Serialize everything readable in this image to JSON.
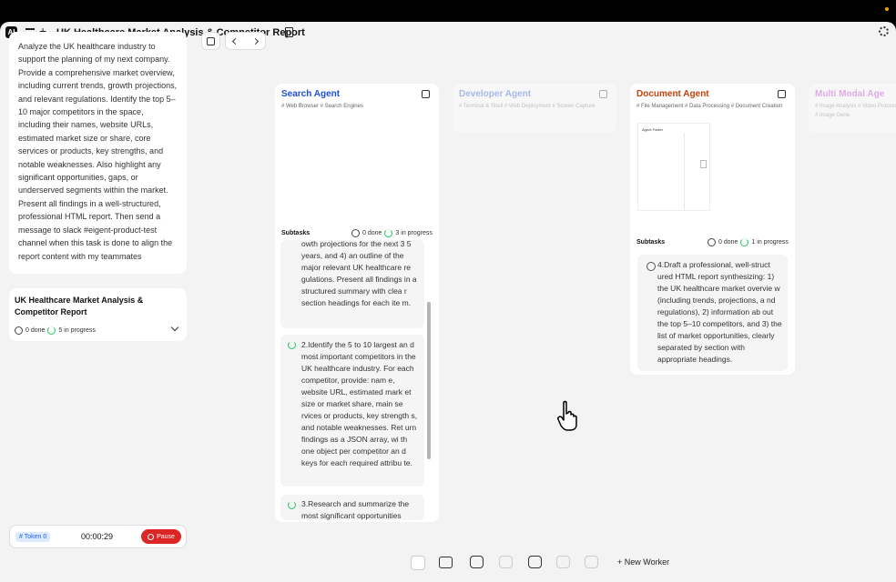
{
  "app": {
    "logo": "AI",
    "title": "UK Healthcare Market Analysis & Competitor Report"
  },
  "prompt": {
    "text": "Analyze the UK healthcare industry to support the planning of my next company. Provide a comprehensive market overview, including current trends, growth projections, and relevant regulations. Identify the top 5–10 major competitors in the space, including their names, website URLs, estimated market size or share, core services or products, key strengths, and notable weaknesses. Also highlight any significant opportunities, gaps, or underserved segments within the market. Present all findings in a well-structured, professional HTML report. Then send a message to slack #eigent-product-test channel when this task is done to align the report content with my teammates"
  },
  "task": {
    "title": "UK Healthcare Market Analysis & Competitor Report",
    "done": "0 done",
    "in_progress": "5 in progress"
  },
  "controls": {
    "token": "# Token 0",
    "timer": "00:00:29",
    "pause": "Pause"
  },
  "agents": [
    {
      "name": "Search Agent",
      "tags": "# Web Browser # Search Engines",
      "color": "#1d4ed8",
      "subtasks_label": "Subtasks",
      "done": "0 done",
      "in_progress": "3 in progress",
      "subtasks": [
        {
          "text": "owth projections for the next 3 5 years, and 4) an outline of the major relevant UK healthcare re gulations. Present all findings in a structured summary with clea r section headings for each ite m.",
          "status": "active"
        },
        {
          "text": "2.Identify the 5 to 10 largest an d most important competitors in the UK healthcare industry. For each competitor, provide: nam e, website URL, estimated mark et size or market share, main se rvices or products, key strength s, and notable weaknesses. Ret urn findings as a JSON array, wi th one object per competitor an d keys for each required attribu te.",
          "status": "active"
        },
        {
          "text": "3.Research and summarize the most significant opportunities",
          "status": "active"
        }
      ]
    },
    {
      "name": "Developer Agent",
      "tags": "# Terminal & Shell # Web Deployment # Screen Capture",
      "color": "#1d4ed8"
    },
    {
      "name": "Document Agent",
      "tags": "# File Management # Data Processing # Document Creation",
      "color": "#c2410c",
      "preview_header": "Agent Folder",
      "subtasks_label": "Subtasks",
      "done": "0 done",
      "in_progress": "1 in progress",
      "subtasks": [
        {
          "text": "4.Draft a professional, well-struct ured HTML report synthesizing: 1) the UK healthcare market overvie w (including trends, projections, a nd regulations), 2) information ab out the top 5–10 competitors, and 3) the list of market opportunities, clearly separated by section with appropriate headings.",
          "status": "pending"
        }
      ]
    },
    {
      "name": "Multi Modal Age",
      "tags": "# Image Analysis # Video Processing # Image Gene",
      "color": "#c026d3"
    }
  ],
  "dock": {
    "new_worker": "New Worker"
  }
}
